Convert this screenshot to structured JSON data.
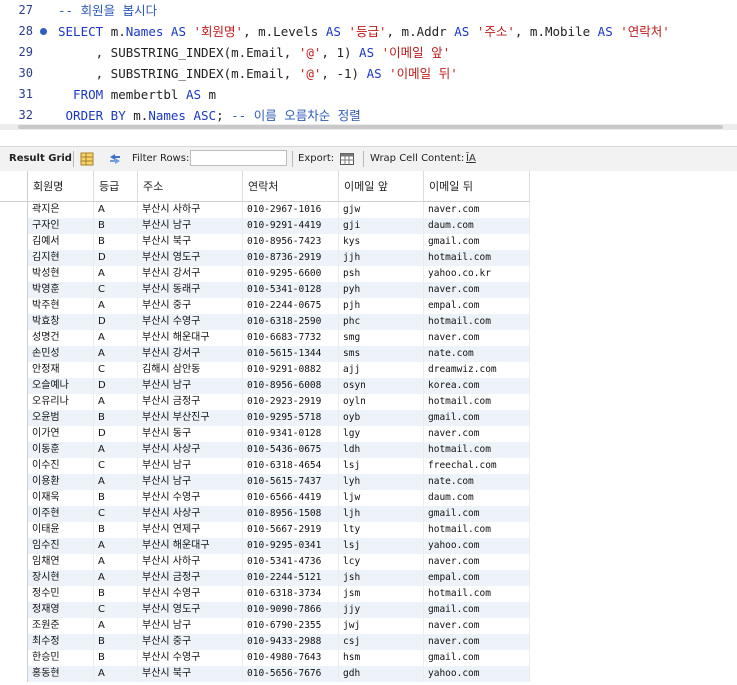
{
  "editor": {
    "lines": [
      {
        "num": "27",
        "breakpoint": false,
        "tokens": [
          {
            "t": "cmt",
            "v": "-- 회원을 봅시다"
          }
        ]
      },
      {
        "num": "28",
        "breakpoint": true,
        "tokens": [
          {
            "t": "kw",
            "v": "SELECT "
          },
          {
            "t": "fn",
            "v": "m."
          },
          {
            "t": "kw",
            "v": "Names"
          },
          {
            "t": "kw",
            "v": " AS "
          },
          {
            "t": "str",
            "v": "'회원명'"
          },
          {
            "t": "fn",
            "v": ", m.Levels "
          },
          {
            "t": "kw",
            "v": "AS "
          },
          {
            "t": "str",
            "v": "'등급'"
          },
          {
            "t": "fn",
            "v": ", m.Addr "
          },
          {
            "t": "kw",
            "v": "AS "
          },
          {
            "t": "str",
            "v": "'주소'"
          },
          {
            "t": "fn",
            "v": ", m.Mobile "
          },
          {
            "t": "kw",
            "v": "AS "
          },
          {
            "t": "str",
            "v": "'연락처'"
          }
        ]
      },
      {
        "num": "29",
        "breakpoint": false,
        "tokens": [
          {
            "t": "fn",
            "v": "     , SUBSTRING_INDEX(m.Email, "
          },
          {
            "t": "str",
            "v": "'@'"
          },
          {
            "t": "fn",
            "v": ", 1) "
          },
          {
            "t": "kw",
            "v": "AS "
          },
          {
            "t": "str",
            "v": "'이메일 앞'"
          }
        ]
      },
      {
        "num": "30",
        "breakpoint": false,
        "tokens": [
          {
            "t": "fn",
            "v": "     , SUBSTRING_INDEX(m.Email, "
          },
          {
            "t": "str",
            "v": "'@'"
          },
          {
            "t": "fn",
            "v": ", -1) "
          },
          {
            "t": "kw",
            "v": "AS "
          },
          {
            "t": "str",
            "v": "'이메일 뒤'"
          }
        ]
      },
      {
        "num": "31",
        "breakpoint": false,
        "tokens": [
          {
            "t": "kw",
            "v": "  FROM "
          },
          {
            "t": "fn",
            "v": "membertbl "
          },
          {
            "t": "kw",
            "v": "AS "
          },
          {
            "t": "fn",
            "v": "m"
          }
        ]
      },
      {
        "num": "32",
        "breakpoint": false,
        "tokens": [
          {
            "t": "kw",
            "v": " ORDER BY "
          },
          {
            "t": "fn",
            "v": "m."
          },
          {
            "t": "kw",
            "v": "Names ASC"
          },
          {
            "t": "fn",
            "v": "; "
          },
          {
            "t": "cmt",
            "v": "-- 이름 오름차순 정렬"
          }
        ]
      }
    ]
  },
  "toolbar": {
    "result_tab": "Result Grid",
    "filter_label": "Filter Rows:",
    "filter_value": "",
    "export_label": "Export:",
    "wrap_label": "Wrap Cell Content:",
    "wrap_icon_glyph": "ĪA"
  },
  "grid": {
    "columns": [
      "회원명",
      "등급",
      "주소",
      "연락처",
      "이메일 앞",
      "이메일 뒤"
    ],
    "rows": [
      [
        "곽지은",
        "A",
        "부산시 사하구",
        "010-2967-1016",
        "gjw",
        "naver.com"
      ],
      [
        "구자인",
        "B",
        "부산시 남구",
        "010-9291-4419",
        "gji",
        "daum.com"
      ],
      [
        "김예서",
        "B",
        "부산시 북구",
        "010-8956-7423",
        "kys",
        "gmail.com"
      ],
      [
        "김지현",
        "D",
        "부산시 영도구",
        "010-8736-2919",
        "jjh",
        "hotmail.com"
      ],
      [
        "박성현",
        "A",
        "부산시 강서구",
        "010-9295-6600",
        "psh",
        "yahoo.co.kr"
      ],
      [
        "박영훈",
        "C",
        "부산시 동래구",
        "010-5341-0128",
        "pyh",
        "naver.com"
      ],
      [
        "박주현",
        "A",
        "부산시 중구",
        "010-2244-0675",
        "pjh",
        "empal.com"
      ],
      [
        "박효창",
        "D",
        "부산시 수영구",
        "010-6318-2590",
        "phc",
        "hotmail.com"
      ],
      [
        "성명건",
        "A",
        "부산시 해운대구",
        "010-6683-7732",
        "smg",
        "naver.com"
      ],
      [
        "손민성",
        "A",
        "부산시 강서구",
        "010-5615-1344",
        "sms",
        "nate.com"
      ],
      [
        "안정재",
        "C",
        "김해시 삼안동",
        "010-9291-0882",
        "ajj",
        "dreamwiz.com"
      ],
      [
        "오슬예나",
        "D",
        "부산시 남구",
        "010-8956-6008",
        "osyn",
        "korea.com"
      ],
      [
        "오유리나",
        "A",
        "부산시 금정구",
        "010-2923-2919",
        "oyln",
        "hotmail.com"
      ],
      [
        "오윤범",
        "B",
        "부산시 부산진구",
        "010-9295-5718",
        "oyb",
        "gmail.com"
      ],
      [
        "이가연",
        "D",
        "부산시 동구",
        "010-9341-0128",
        "lgy",
        "naver.com"
      ],
      [
        "이동훈",
        "A",
        "부산시 사상구",
        "010-5436-0675",
        "ldh",
        "hotmail.com"
      ],
      [
        "이수진",
        "C",
        "부산시 남구",
        "010-6318-4654",
        "lsj",
        "freechal.com"
      ],
      [
        "이용환",
        "A",
        "부산시 남구",
        "010-5615-7437",
        "lyh",
        "nate.com"
      ],
      [
        "이재욱",
        "B",
        "부산시 수영구",
        "010-6566-4419",
        "ljw",
        "daum.com"
      ],
      [
        "이주현",
        "C",
        "부산시 사상구",
        "010-8956-1508",
        "ljh",
        "gmail.com"
      ],
      [
        "이태윤",
        "B",
        "부산시 연제구",
        "010-5667-2919",
        "lty",
        "hotmail.com"
      ],
      [
        "임수진",
        "A",
        "부산시 해운대구",
        "010-9295-0341",
        "lsj",
        "yahoo.com"
      ],
      [
        "임채연",
        "A",
        "부산시 사하구",
        "010-5341-4736",
        "lcy",
        "naver.com"
      ],
      [
        "장시현",
        "A",
        "부산시 금정구",
        "010-2244-5121",
        "jsh",
        "empal.com"
      ],
      [
        "정수민",
        "B",
        "부산시 수영구",
        "010-6318-3734",
        "jsm",
        "hotmail.com"
      ],
      [
        "정재영",
        "C",
        "부산시 영도구",
        "010-9090-7866",
        "jjy",
        "gmail.com"
      ],
      [
        "조원준",
        "A",
        "부산시 남구",
        "010-6790-2355",
        "jwj",
        "naver.com"
      ],
      [
        "최수정",
        "B",
        "부산시 중구",
        "010-9433-2988",
        "csj",
        "naver.com"
      ],
      [
        "한승민",
        "B",
        "부산시 수영구",
        "010-4980-7643",
        "hsm",
        "gmail.com"
      ],
      [
        "홍동현",
        "A",
        "부산시 북구",
        "010-5656-7676",
        "gdh",
        "yahoo.com"
      ]
    ]
  }
}
